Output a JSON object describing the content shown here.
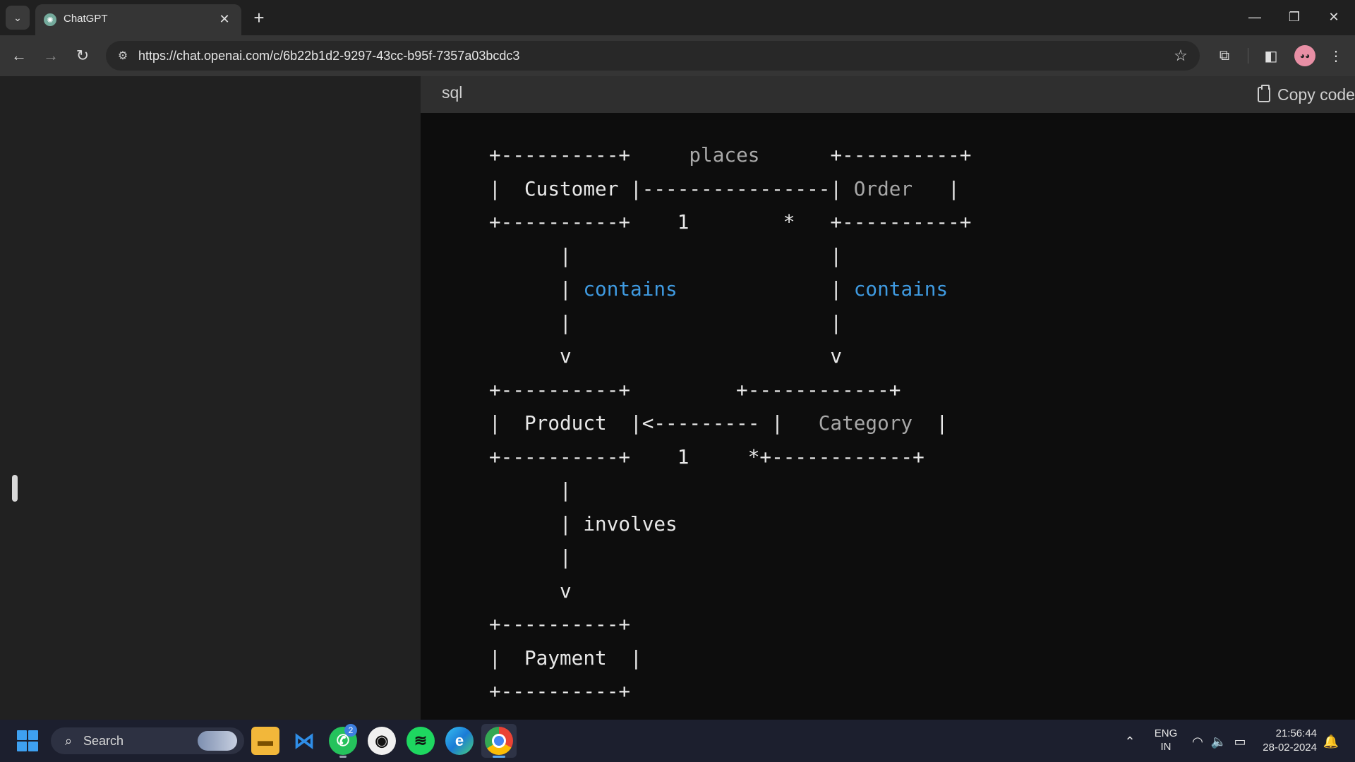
{
  "browser": {
    "tab": {
      "title": "ChatGPT",
      "close": "✕"
    },
    "new_tab": "+",
    "window": {
      "minimize": "—",
      "restore": "❐",
      "close": "✕"
    },
    "url": "https://chat.openai.com/c/6b22b1d2-9297-43cc-b95f-7357a03bcdc3"
  },
  "code_block": {
    "language": "sql",
    "copy_label": "Copy code",
    "lines": [
      [
        {
          "t": "+----------+     "
        },
        {
          "t": "places",
          "c": "dim"
        },
        {
          "t": "      +----------+"
        }
      ],
      [
        {
          "t": "|  Customer |----------------| "
        },
        {
          "t": "Order",
          "c": "dim"
        },
        {
          "t": "   |"
        }
      ],
      [
        {
          "t": "+----------+    1        *   +----------+"
        }
      ],
      [
        {
          "t": "      |                      |"
        }
      ],
      [
        {
          "t": "      | "
        },
        {
          "t": "contains",
          "c": "kw"
        },
        {
          "t": "             | "
        },
        {
          "t": "contains",
          "c": "kw"
        }
      ],
      [
        {
          "t": "      |                      |"
        }
      ],
      [
        {
          "t": "      v                      v"
        }
      ],
      [
        {
          "t": "+----------+         +------------+"
        }
      ],
      [
        {
          "t": "|  Product  |<--------- |   "
        },
        {
          "t": "Category",
          "c": "dim"
        },
        {
          "t": "  |"
        }
      ],
      [
        {
          "t": "+----------+    1     *+------------+"
        }
      ],
      [
        {
          "t": "      |"
        }
      ],
      [
        {
          "t": "      | involves"
        }
      ],
      [
        {
          "t": "      |"
        }
      ],
      [
        {
          "t": "      v"
        }
      ],
      [
        {
          "t": "+----------+"
        }
      ],
      [
        {
          "t": "|  Payment  |"
        }
      ],
      [
        {
          "t": "+----------+"
        }
      ]
    ]
  },
  "taskbar": {
    "search_label": "Search",
    "whatsapp_badge": "2",
    "language": {
      "line1": "ENG",
      "line2": "IN"
    },
    "clock": {
      "time": "21:56:44",
      "date": "28-02-2024"
    }
  },
  "colors": {
    "keyword": "#3f9ae0",
    "code_background": "#0d0d0d",
    "sidebar_background": "#212121",
    "taskbar_background": "#1c1f2e"
  },
  "icons": {
    "tab_search": "chevron-down-icon",
    "favicon": "chatgpt-logo-icon",
    "back": "back-arrow-icon",
    "forward": "forward-arrow-icon",
    "reload": "reload-icon",
    "site_info": "site-info-icon",
    "bookmark": "star-icon",
    "extensions": "puzzle-icon",
    "side_panel": "side-panel-icon",
    "menu": "kebab-menu-icon",
    "copy": "clipboard-icon",
    "start": "windows-logo-icon",
    "search": "search-icon"
  }
}
